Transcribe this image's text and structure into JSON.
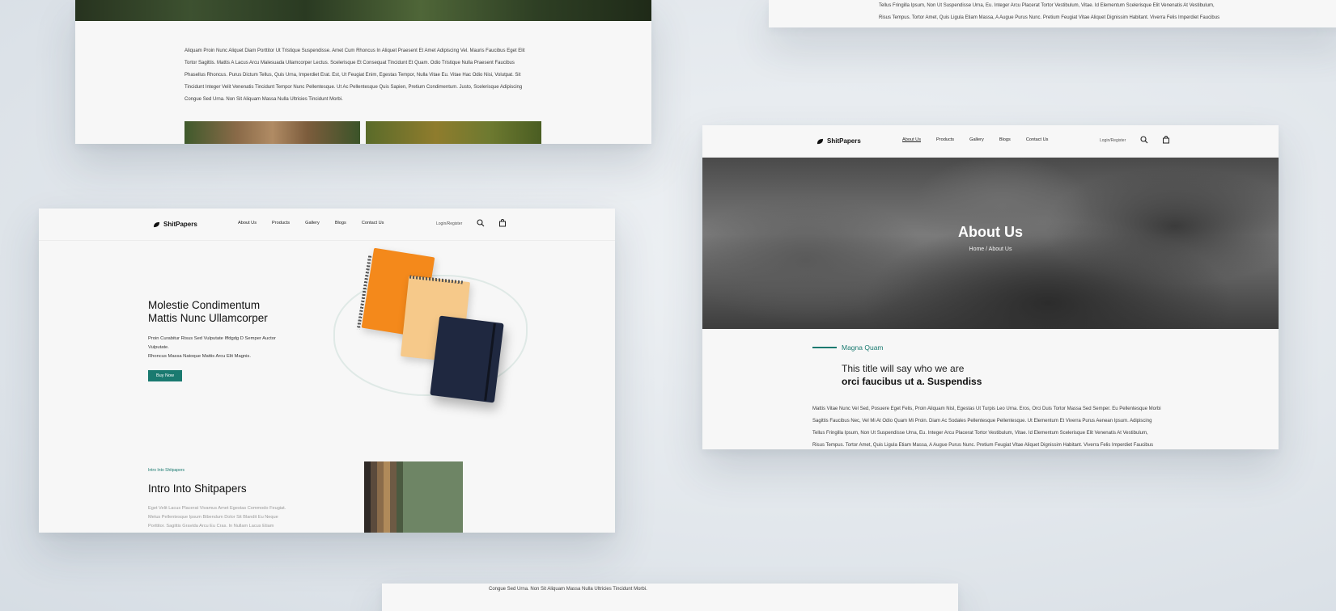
{
  "brand": {
    "name": "ShitPapers",
    "accent_color": "#1a7a70"
  },
  "nav": {
    "items": [
      "About Us",
      "Products",
      "Gallery",
      "Blogs",
      "Contact Us"
    ],
    "login_label": "Login/Register"
  },
  "card_a": {
    "lines": [
      "Aliquam Proin Nunc Aliquet Diam Porttitor Ut Tristique Suspendisse. Amet Cum Rhoncus In Aliquet Praesent Et Amet Adipiscing Vel. Mauris Faucibus Eget Elit",
      "Tortor Sagittis. Mattis A Lacus Arcu Malesuada Ullamcorper Lectus. Scelerisque Et Consequat Tincidunt Et Quam. Odio Tristique Nulla Praesent Faucibus",
      "Phasellus Rhoncus. Purus Dictum Tellus, Quis Urna, Imperdiet Erat. Est, Ut Feugiat Enim, Egestas Tempor, Nulla Vitae Eu. Vitae Hac Odio Nisi, Volutpat. Sit",
      "Tincidunt Integer Velit Venenatis Tincidunt Tempor Nunc Pellentesque. Ut Ac Pellentesque Quis Sapien, Pretium Condimentum. Justo, Scelerisque Adipiscing",
      "Congue Sed Urna. Non Sit Aliquam Massa Nulla Ultricies Tincidunt Morbi."
    ]
  },
  "card_b": {
    "lines": [
      "Tellus Fringilla Ipsum, Non Ut Suspendisse Urna, Eu. Integer Arcu Placerat Tortor Vestibulum, Vitae. Id Elementum Scelerisque Elit Venenatis At Vestibulum,",
      "Risus Tempus. Tortor Amet, Quis Ligula Etiam Massa, A Augue Purus Nunc. Pretium Feugiat Vitae Aliquet Dignissim Habitant. Viverra Felis Imperdiet Faucibus"
    ]
  },
  "home": {
    "hero_title_line1": "Molestie Condimentum",
    "hero_title_line2": "Mattis Nunc Ullamcorper",
    "hero_sub_line1": "Proin Curabitur Risus Sed Vulputate Iffdgdg D Semper Auctor",
    "hero_sub_line2": "Vulputate.",
    "hero_sub_line3": "Rhoncus Massa Natoque Mattis Arcu Elit Magnis.",
    "buy_button": "Buy Now",
    "intro_label": "Intro Into Shitpapers",
    "intro_title": "Intro Into Shitpapers",
    "intro_line1": "Eget Velit Lacus Placerat Vivamus Amet Egestas Commodo Feugiat.",
    "intro_line2": "Metus Pellentesque Ipsum Bibendum Dolor Sit Blandit Eu Neque",
    "intro_line3": "Porttitor. Sagittis Gravida Arcu Eu Cras. In Nullam Lacus Etiam"
  },
  "about": {
    "title": "About Us",
    "breadcrumb": "Home / About Us",
    "section_label": "Magna Quam",
    "heading_line1": "This title will say who we are",
    "heading_line2": "orci faucibus ut a. Suspendiss",
    "lines": [
      "Mattis Vitae Nunc Vel Sed, Posuere Eget Felis, Proin Aliquam Nisl, Egestas Ut Turpis Leo Urna. Eros, Orci Duis Tortor Massa Sed Semper. Eu Pellentesque Morbi",
      "Sagittis Faucibus Nec, Vel Mi At Odio Quam Mi Proin. Diam Ac Sodales Pellentesque Pellentesque. Ut Elementum Et Viverra Purus Aenean Ipsum. Adipiscing",
      "Tellus Fringilla Ipsum, Non Ut Suspendisse Urna, Eu. Integer Arcu Placerat Tortor Vestibulum, Vitae. Id Elementum Scelerisque Elit Venenatis At Vestibulum,",
      "Risus Tempus. Tortor Amet, Quis Ligula Etiam Massa, A Augue Purus Nunc. Pretium Feugiat Vitae Aliquet Dignissim Habitant. Viverra Felis Imperdiet Faucibus"
    ]
  },
  "card_e": {
    "lines": [
      "Congue Sed Urna. Non Sit Aliquam Massa Nulla Ultricies Tincidunt Morbi."
    ]
  },
  "icons": {
    "search": "search-icon",
    "cart": "shopping-bag-icon",
    "logo": "leaf-logo-icon"
  }
}
